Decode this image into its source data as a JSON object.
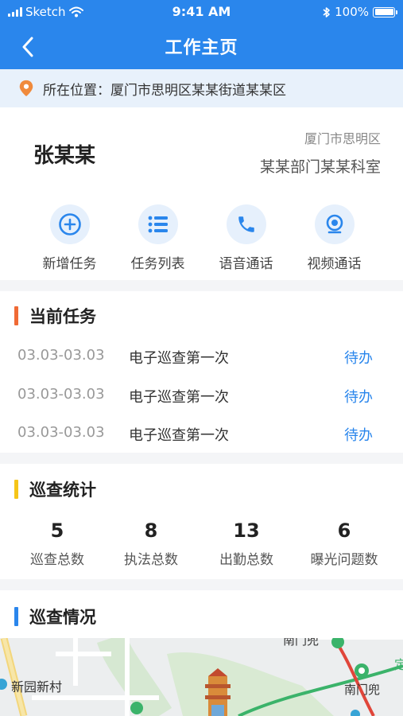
{
  "status_bar": {
    "carrier": "Sketch",
    "time": "9:41 AM",
    "battery": "100%"
  },
  "nav": {
    "title": "工作主页",
    "back_icon": "chevron-left-icon"
  },
  "location": {
    "text": "所在位置：厦门市思明区某某街道某某区",
    "icon": "map-pin-icon",
    "icon_color": "#f08a3c"
  },
  "profile": {
    "name": "张某某",
    "district": "厦门市思明区",
    "department": "某某部门某某科室"
  },
  "actions": [
    {
      "label": "新增任务",
      "icon": "plus-circle-icon"
    },
    {
      "label": "任务列表",
      "icon": "list-icon"
    },
    {
      "label": "语音通话",
      "icon": "phone-icon"
    },
    {
      "label": "视频通话",
      "icon": "video-camera-icon"
    }
  ],
  "current_tasks": {
    "title": "当前任务",
    "accent": "#f06a35",
    "items": [
      {
        "date": "03.03-03.03",
        "desc": "电子巡查第一次",
        "status": "待办"
      },
      {
        "date": "03.03-03.03",
        "desc": "电子巡查第一次",
        "status": "待办"
      },
      {
        "date": "03.03-03.03",
        "desc": "电子巡查第一次",
        "status": "待办"
      }
    ]
  },
  "stats": {
    "title": "巡查统计",
    "accent": "#f5c518",
    "items": [
      {
        "value": "5",
        "label": "巡查总数"
      },
      {
        "value": "8",
        "label": "执法总数"
      },
      {
        "value": "13",
        "label": "出勤总数"
      },
      {
        "value": "6",
        "label": "曝光问题数"
      }
    ]
  },
  "patrol": {
    "title": "巡查情况",
    "accent": "#2a86ec"
  },
  "map": {
    "places": [
      "新园新村",
      "南门兜",
      "南门兜",
      "定"
    ]
  },
  "colors": {
    "primary": "#2a86ec",
    "background": "#f4f5f7"
  }
}
